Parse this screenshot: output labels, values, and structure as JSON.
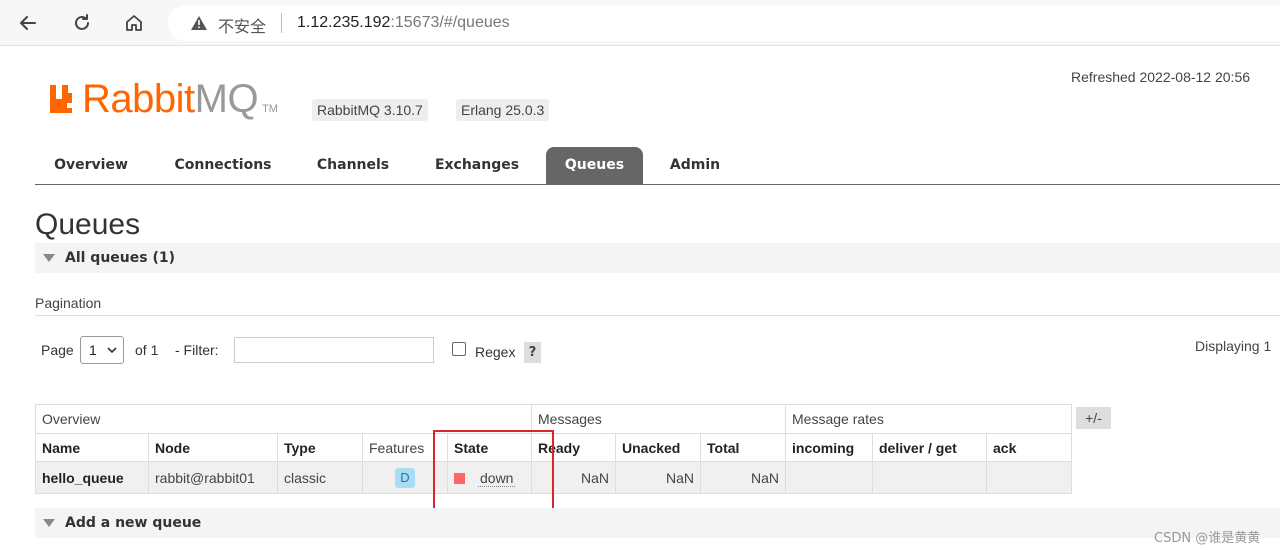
{
  "browser": {
    "insecure_label": "不安全",
    "url_host": "1.12.235.192",
    "url_rest": ":15673/#/queues"
  },
  "header": {
    "logo_main": "Rabbit",
    "logo_mq": "MQ",
    "logo_tm": "TM",
    "rabbitmq_version": "RabbitMQ 3.10.7",
    "erlang_version": "Erlang 25.0.3",
    "refreshed": "Refreshed 2022-08-12 20:56"
  },
  "tabs": [
    {
      "label": "Overview"
    },
    {
      "label": "Connections"
    },
    {
      "label": "Channels"
    },
    {
      "label": "Exchanges"
    },
    {
      "label": "Queues",
      "active": true
    },
    {
      "label": "Admin"
    }
  ],
  "page_title": "Queues",
  "all_queues_label": "All queues (1)",
  "pagination": {
    "section_label": "Pagination",
    "page_label": "Page",
    "page_value": "1",
    "of_label": "of 1",
    "filter_label": "- Filter:",
    "filter_value": "",
    "regex_label": "Regex",
    "help_label": "?",
    "displaying": "Displaying 1"
  },
  "table": {
    "groups": {
      "overview": "Overview",
      "messages": "Messages",
      "message_rates": "Message rates"
    },
    "columns": {
      "name": "Name",
      "node": "Node",
      "type": "Type",
      "features": "Features",
      "state": "State",
      "ready": "Ready",
      "unacked": "Unacked",
      "total": "Total",
      "incoming": "incoming",
      "deliver_get": "deliver / get",
      "ack": "ack"
    },
    "rows": [
      {
        "name": "hello_queue",
        "node": "rabbit@rabbit01",
        "type": "classic",
        "features": "D",
        "state": "down",
        "ready": "NaN",
        "unacked": "NaN",
        "total": "NaN",
        "incoming": "",
        "deliver_get": "",
        "ack": ""
      }
    ],
    "plus_minus": "+/-"
  },
  "add_queue_label": "Add a new queue",
  "watermark": "CSDN @谁是黄黄",
  "colors": {
    "brand_orange": "#ff6600",
    "tab_active_bg": "#666666",
    "state_down": "#ff6666",
    "highlight": "#d9262c"
  }
}
